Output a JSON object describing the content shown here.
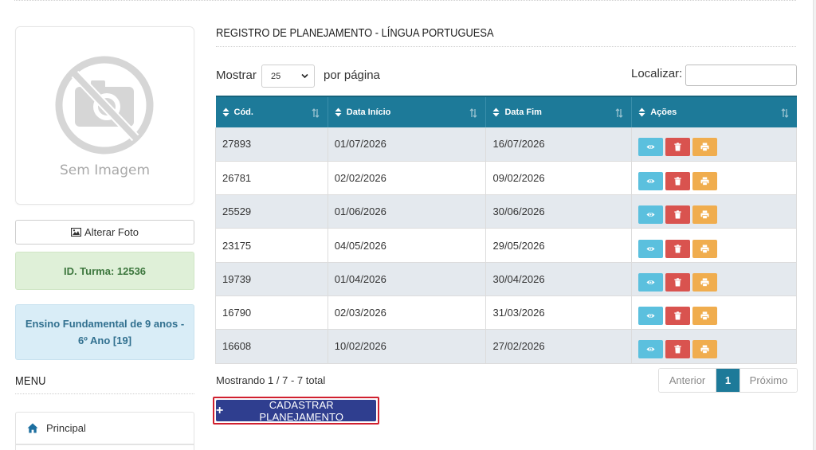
{
  "sidebar": {
    "no_image_text": "Sem Imagem",
    "change_photo_label": "Alterar Foto",
    "turma_label": "ID. Turma: 12536",
    "ensino_label": "Ensino Fundamental de 9 anos - 6º Ano [19]",
    "menu_title": "MENU",
    "menu_items": [
      {
        "label": "Principal",
        "icon": "home-icon"
      }
    ]
  },
  "main": {
    "title": "REGISTRO DE PLANEJAMENTO - LÍNGUA PORTUGUESA",
    "show_label": "Mostrar",
    "per_page_value": "25",
    "per_page_suffix": "por página",
    "search_label": "Localizar:",
    "search_value": "",
    "columns": [
      "Cód.",
      "Data Início",
      "Data Fim",
      "Ações"
    ],
    "rows": [
      {
        "code": "27893",
        "start": "01/07/2026",
        "end": "16/07/2026"
      },
      {
        "code": "26781",
        "start": "02/02/2026",
        "end": "09/02/2026"
      },
      {
        "code": "25529",
        "start": "01/06/2026",
        "end": "30/06/2026"
      },
      {
        "code": "23175",
        "start": "04/05/2026",
        "end": "29/05/2026"
      },
      {
        "code": "19739",
        "start": "01/04/2026",
        "end": "30/04/2026"
      },
      {
        "code": "16790",
        "start": "02/03/2026",
        "end": "31/03/2026"
      },
      {
        "code": "16608",
        "start": "10/02/2026",
        "end": "27/02/2026"
      }
    ],
    "showing_info": "Mostrando 1 / 7 - 7 total",
    "pagination": {
      "prev": "Anterior",
      "current": "1",
      "next": "Próximo"
    },
    "add_button_label": "CADASTRAR PLANEJAMENTO"
  },
  "colors": {
    "header_bg": "#1d7a99",
    "view": "#5bc0de",
    "delete": "#d9534f",
    "print": "#f0ad4e",
    "add_button": "#2f3e8f",
    "highlight_border": "#d0202f"
  }
}
